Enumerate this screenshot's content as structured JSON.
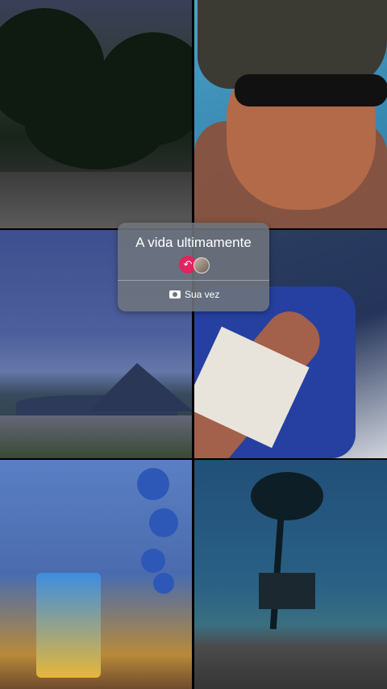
{
  "prompt_card": {
    "title": "A vida ultimamente",
    "action_label": "Sua vez",
    "icons": [
      "reply-arrow-icon",
      "avatar",
      "camera-icon"
    ]
  },
  "tiles": [
    "park-trees-photo",
    "selfie-pool-photo",
    "mountain-bay-photo",
    "arm-iv-photo",
    "sonic-party-photo",
    "palm-beach-photo"
  ],
  "colors": {
    "card_bg": "#6e747c",
    "reply_badge": "#e2235e",
    "text": "#ffffff"
  }
}
